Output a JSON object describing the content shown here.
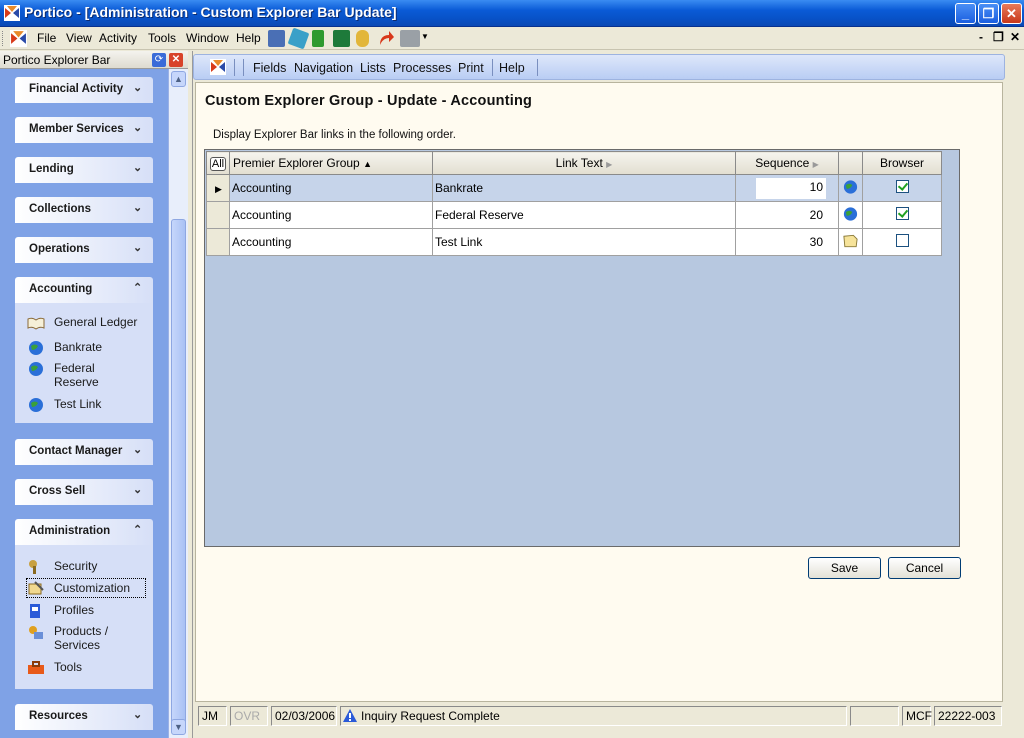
{
  "window": {
    "title": "Portico - [Administration - Custom Explorer Bar Update]",
    "minimize_glyph": "_",
    "maximize_glyph": "❐",
    "close_glyph": "✕"
  },
  "menubar": {
    "items": [
      "File",
      "View",
      "Activity",
      "Tools",
      "Window",
      "Help"
    ],
    "mdi_minimize": "-",
    "mdi_restore": "❐",
    "mdi_close": "✕"
  },
  "explorer": {
    "title": "Portico Explorer Bar",
    "sections": {
      "financial_activity": "Financial Activity",
      "member_services": "Member Services",
      "lending": "Lending",
      "collections": "Collections",
      "operations": "Operations",
      "accounting": "Accounting",
      "contact_manager": "Contact Manager",
      "cross_sell": "Cross Sell",
      "administration": "Administration",
      "resources": "Resources"
    },
    "accounting_links": [
      "General Ledger",
      "Bankrate",
      "Federal Reserve",
      "Test Link"
    ],
    "administration_links": [
      "Security",
      "Customization",
      "Profiles",
      "Products / Services",
      "Tools"
    ]
  },
  "toolbar": {
    "items": [
      "Fields",
      "Navigation",
      "Lists",
      "Processes",
      "Print",
      "Help"
    ]
  },
  "page": {
    "heading": "Custom Explorer Group - Update - Accounting",
    "instruction": "Display Explorer Bar links in the following order."
  },
  "grid": {
    "select_all": "All",
    "columns": {
      "group": "Premier Explorer Group",
      "link_text": "Link Text",
      "sequence": "Sequence",
      "browser": "Browser"
    },
    "rows": [
      {
        "group": "Accounting",
        "link_text": "Bankrate",
        "sequence": "10",
        "browser": true,
        "icon": "globe-icon"
      },
      {
        "group": "Accounting",
        "link_text": "Federal Reserve",
        "sequence": "20",
        "browser": true,
        "icon": "globe-icon"
      },
      {
        "group": "Accounting",
        "link_text": "Test Link",
        "sequence": "30",
        "browser": false,
        "icon": "note-icon"
      }
    ]
  },
  "buttons": {
    "save": "Save",
    "cancel": "Cancel"
  },
  "statusbar": {
    "user": "JM",
    "ovr": "OVR",
    "date": "02/03/2006",
    "message": "Inquiry Request Complete",
    "mode": "MCF",
    "account": "22222-003"
  }
}
